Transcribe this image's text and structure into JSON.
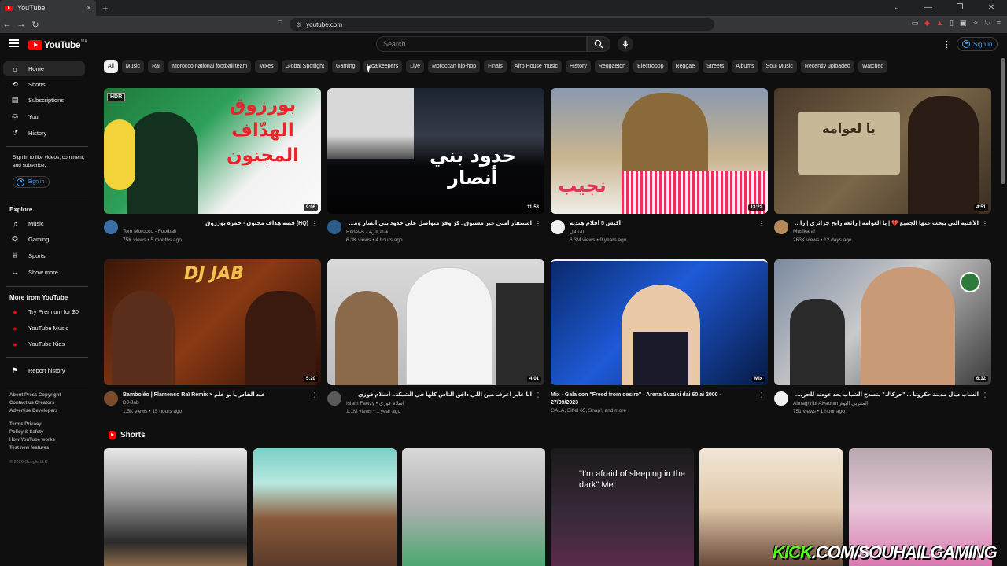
{
  "browser": {
    "tab_title": "YouTube",
    "tab_close": "×",
    "new_tab": "+",
    "url": "youtube.com",
    "window_controls": [
      "⌄",
      "—",
      "❐",
      "✕"
    ]
  },
  "header": {
    "logo_text": "YouTube",
    "region": "MA",
    "search_placeholder": "Search",
    "signin_label": "Sign in"
  },
  "sidebar": {
    "main_items": [
      {
        "label": "Home",
        "icon": "home-icon"
      },
      {
        "label": "Shorts",
        "icon": "shorts-icon"
      },
      {
        "label": "Subscriptions",
        "icon": "subscriptions-icon"
      },
      {
        "label": "You",
        "icon": "you-icon"
      },
      {
        "label": "History",
        "icon": "history-icon"
      }
    ],
    "signin_note": "Sign in to like videos, comment, and subscribe.",
    "signin_label": "Sign in",
    "explore_heading": "Explore",
    "explore_items": [
      {
        "label": "Music",
        "icon": "music-icon"
      },
      {
        "label": "Gaming",
        "icon": "gaming-icon"
      },
      {
        "label": "Sports",
        "icon": "sports-icon"
      },
      {
        "label": "Show more",
        "icon": "chevron-down-icon"
      }
    ],
    "more_heading": "More from YouTube",
    "more_items": [
      {
        "label": "Try Premium for $0"
      },
      {
        "label": "YouTube Music"
      },
      {
        "label": "YouTube Kids"
      }
    ],
    "report_history": "Report history",
    "footer_line1": "About  Press  Copyright",
    "footer_line2": "Contact us  Creators",
    "footer_line3": "Advertise  Developers",
    "footer_line4": "Terms  Privacy",
    "footer_line5": "Policy & Safety",
    "footer_line6": "How YouTube works",
    "footer_line7": "Test new features",
    "copyright": "© 2026 Google LLC"
  },
  "chips": [
    "All",
    "Music",
    "Raï",
    "Morocco national football team",
    "Mixes",
    "Global Spotlight",
    "Gaming",
    "Goalkeepers",
    "Live",
    "Moroccan hip-hop",
    "Finals",
    "Afro House music",
    "History",
    "Reggaeton",
    "Electropop",
    "Reggae",
    "Streets",
    "Albums",
    "Soul Music",
    "Recently uploaded",
    "Watched"
  ],
  "videos": [
    {
      "title": "(HQ) قصة هداف مجنون - حمزة بورزوق",
      "channel": "Tom Morocco - Football",
      "stats": "75K views • 5 months ago",
      "duration": "9:06",
      "badge": "HDR",
      "overlay": "بورزوق الهدّاف المجنون"
    },
    {
      "title": "استنفار أمني غير مسبوق.. كرّ وفرّ متواصل على حدود بني أنصار ومطاردات لليوم الثالث",
      "channel": "Rifnews قناة الريف",
      "stats": "6.3K views • 4 hours ago",
      "duration": "11:53",
      "overlay": "حدود بني أنصار"
    },
    {
      "title": "أكبس 5 أفلام هندية",
      "channel": "الشلال",
      "stats": "6.3M views • 9 years ago",
      "duration": "13:22",
      "overlay": "نجيب"
    },
    {
      "title": "الأغنية التي يبحث عنها الجميع 💔 | يا العوامة | رائعة رابح جزائري | راي جزائري",
      "channel": "Musikarai",
      "stats": "263K views • 12 days ago",
      "duration": "4:51",
      "overlay": "يا لعوامة"
    },
    {
      "title": "Bamboléo | Flamenco Raï Remix × عبد القادر يا بو علم",
      "channel": "DJ-Jab",
      "stats": "1.5K views • 15 hours ago",
      "duration": "5:20",
      "overlay": "DJ JAB"
    },
    {
      "title": "انا عايز اعرف مين اللي داقق الناس كلها في الشبكة.. اسلام فوزي",
      "channel": "Islam Fawzy • اسلام فوزي",
      "stats": "1.1M views • 1 year ago",
      "duration": "4:01"
    },
    {
      "title": "Mix - Gala con \"Freed from desire\" - Arena Suzuki dai 60 ai 2000 - 27/09/2023",
      "channel": "GALA, Eiffel 65, Snap!, and more",
      "stats": "",
      "duration": "Mix"
    },
    {
      "title": "الشاب ديال مدينة حكرونا ... \"حركاك\" يتصدح الشباب بعد عودته للحرية بقيادة مشجعين جمهور",
      "channel": "Almaghribi Alyaoum المغربي اليوم",
      "stats": "751 views • 1 hour ago",
      "duration": "6:32"
    }
  ],
  "shorts": {
    "heading": "Shorts",
    "items": [
      {
        "caption": ""
      },
      {
        "caption": ""
      },
      {
        "caption": ""
      },
      {
        "caption": "\"I'm afraid of sleeping in the dark\" Me:"
      },
      {
        "caption": ""
      },
      {
        "caption": ""
      }
    ]
  },
  "watermark": {
    "k": "KICK",
    "rest": ".COM/SOUHAILGAMING"
  }
}
